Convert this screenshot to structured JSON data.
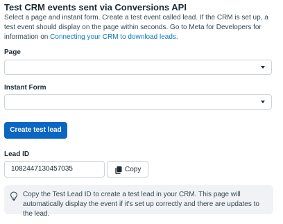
{
  "header": {
    "title": "Test CRM events sent via Conversions API",
    "description": "Select a page and instant form. Create a test event called lead. If the CRM is set up, a test event should display on the page within seconds. Go to Meta for Developers for information on ",
    "link_text": "Connecting your CRM to download leads."
  },
  "page_field": {
    "label": "Page",
    "value": ""
  },
  "form_field": {
    "label": "Instant Form",
    "value": ""
  },
  "create_button": {
    "label": "Create test lead"
  },
  "lead_id": {
    "label": "Lead ID",
    "value": "1082447130457035",
    "copy_label": "Copy"
  },
  "info": {
    "text": "Copy the Test Lead ID to create a test lead in your CRM. This page will automatically display the event if it's set up correctly and there are updates to the lead."
  },
  "icons": {
    "dropdown": "chevron-down-icon",
    "copy": "copy-icon",
    "info": "lightbulb-icon"
  },
  "colors": {
    "primary": "#0a66c2",
    "link": "#0a78be",
    "info_bg": "#f0f2f5"
  }
}
